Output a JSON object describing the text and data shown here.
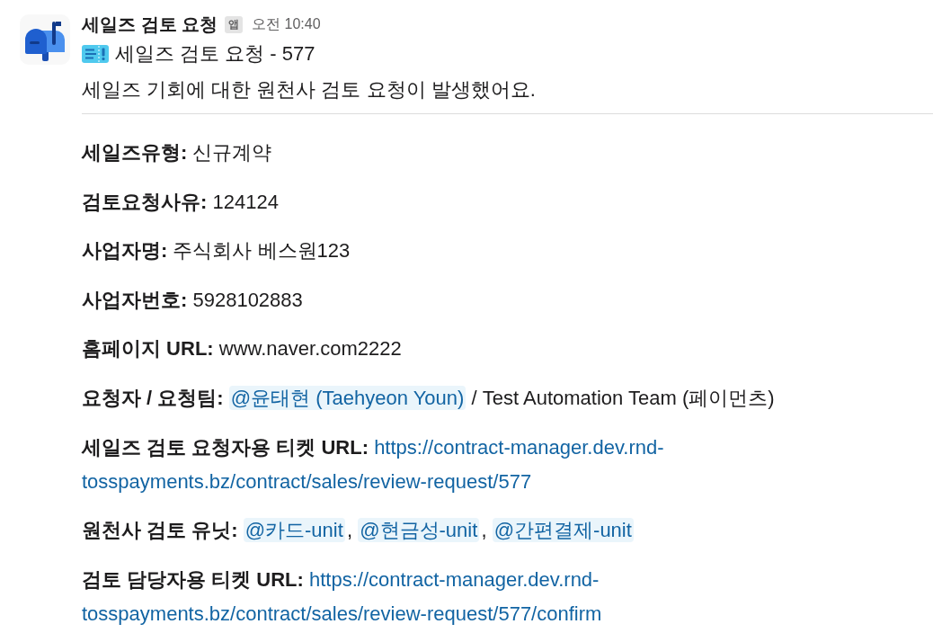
{
  "message": {
    "sender": "세일즈 검토 요청",
    "badge": "앱",
    "time": "오전 10:40",
    "title": "세일즈 검토 요청 - 577",
    "summary": "세일즈 기회에 대한 원천사 검토 요청이 발생했어요."
  },
  "fields": [
    {
      "label": "세일즈유형:",
      "parts": [
        {
          "kind": "text",
          "text": "신규계약"
        }
      ]
    },
    {
      "label": "검토요청사유:",
      "parts": [
        {
          "kind": "text",
          "text": "124124"
        }
      ]
    },
    {
      "label": "사업자명:",
      "parts": [
        {
          "kind": "text",
          "text": "주식회사 베스원123"
        }
      ]
    },
    {
      "label": "사업자번호:",
      "parts": [
        {
          "kind": "text",
          "text": "5928102883"
        }
      ]
    },
    {
      "label": "홈페이지 URL:",
      "parts": [
        {
          "kind": "text",
          "text": "www.naver.com2222"
        }
      ]
    },
    {
      "label": "요청자 / 요청팀:",
      "parts": [
        {
          "kind": "mention",
          "text": "@윤태현 (Taehyeon Youn)"
        },
        {
          "kind": "text",
          "text": "/ Test Automation Team (페이먼츠)"
        }
      ]
    },
    {
      "label": "세일즈 검토 요청자용 티켓 URL:",
      "parts": [
        {
          "kind": "link",
          "lines": [
            "https://contract-manager.dev.rnd-",
            "tosspayments.bz/contract/sales/review-request/577"
          ]
        }
      ]
    },
    {
      "label": "원천사 검토 유닛:",
      "parts": [
        {
          "kind": "mention",
          "text": "@카드-unit"
        },
        {
          "kind": "comma",
          "text": ","
        },
        {
          "kind": "mention",
          "text": "@현금성-unit"
        },
        {
          "kind": "comma",
          "text": ","
        },
        {
          "kind": "mention",
          "text": "@간편결제-unit"
        }
      ]
    },
    {
      "label": "검토 담당자용 티켓 URL:",
      "parts": [
        {
          "kind": "link",
          "lines": [
            "https://contract-manager.dev.rnd-",
            "tosspayments.bz/contract/sales/review-request/577/confirm"
          ]
        }
      ]
    }
  ]
}
